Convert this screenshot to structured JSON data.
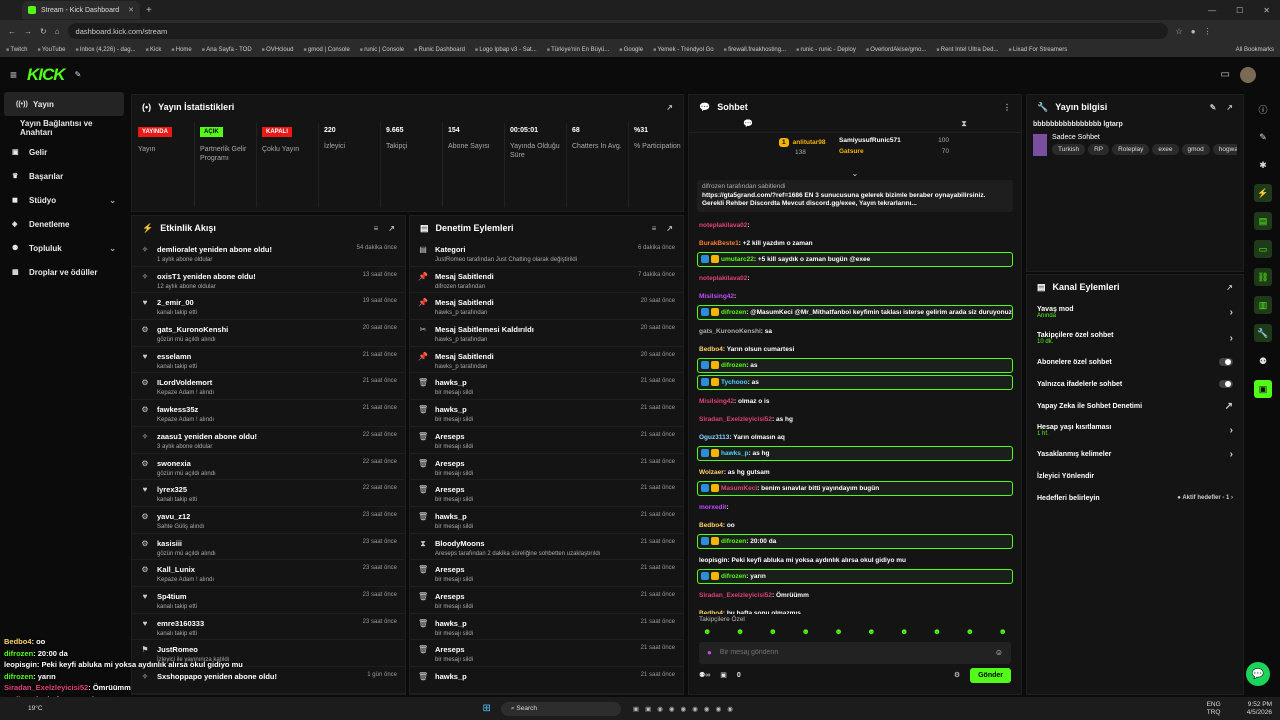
{
  "browser": {
    "tab_title": "Stream - Kick Dashboard",
    "url": "dashboard.kick.com/stream",
    "bookmarks": [
      "Twitch",
      "YouTube",
      "Inbox (4,226) - dag...",
      "Kick",
      "Home",
      "Ana Sayfa - TOD",
      "OVHcloud",
      "gmod | Console",
      "runic | Console",
      "Runic Dashboard",
      "Logo Ipbap v3 - Sat...",
      "Türkiye'nin En Büyü...",
      "Google",
      "Yemek - Trendyol Go",
      "firewall.freakhosting...",
      "runic - runic - Deploy",
      "OverlordAkise/gmo...",
      "Rent Intel Ultra Ded...",
      "Lixad For Streamers"
    ],
    "all_bookmarks": "All Bookmarks"
  },
  "header": {
    "logo": "KICK"
  },
  "sidebar": {
    "items": [
      {
        "label": "Yayın",
        "icon": "broadcast-icon"
      },
      {
        "label": "Yayın Bağlantısı ve Anahtarı",
        "icon": ""
      },
      {
        "label": "Gelir",
        "icon": "money-icon"
      },
      {
        "label": "Başarılar",
        "icon": "trophy-icon"
      },
      {
        "label": "Stüdyo",
        "icon": "studio-icon"
      },
      {
        "label": "Denetleme",
        "icon": "shield-icon"
      },
      {
        "label": "Topluluk",
        "icon": "community-icon"
      },
      {
        "label": "Droplar ve ödüller",
        "icon": "gift-icon"
      }
    ]
  },
  "stats": {
    "title": "Yayın İstatistikleri",
    "items": [
      {
        "badge": "YAYINDA",
        "label": "Yayın",
        "color": "#e91916"
      },
      {
        "badge": "AÇIK",
        "label": "Partnerlik Gelir Programı",
        "color": "#53fc18"
      },
      {
        "badge": "KAPALI",
        "label": "Çoklu Yayın",
        "color": "#e91916"
      },
      {
        "value": "220",
        "label": "İzleyici"
      },
      {
        "value": "9.665",
        "label": "Takipçi"
      },
      {
        "value": "154",
        "label": "Abone Sayısı"
      },
      {
        "value": "00:05:01",
        "label": "Yayında Olduğu Süre"
      },
      {
        "value": "68",
        "label": "Chatters In Avg."
      },
      {
        "value": "%31",
        "label": "% Participation"
      }
    ]
  },
  "activity": {
    "title": "Etkinlik Akışı",
    "rows": [
      {
        "t": "demlioralet yeniden abone oldu!",
        "s": "1 aylık abone oldular",
        "hl": "1",
        "time": "54 dakika önce",
        "icon": "star-icon"
      },
      {
        "t": "oxisT1 yeniden abone oldu!",
        "s": "12 aylık abone oldular",
        "hl": "12",
        "time": "13 saat önce",
        "icon": "star-icon"
      },
      {
        "t": "2_emir_00",
        "s": "kanalı takip etti",
        "hl": "",
        "time": "19 saat önce",
        "icon": "heart-icon"
      },
      {
        "t": "gats_KuronoKenshi",
        "s": "gözün mü açıldı alındı",
        "hl": "gözün mü açıldı",
        "time": "20 saat önce",
        "icon": "reward-icon"
      },
      {
        "t": "esselamn",
        "s": "kanalı takip etti",
        "hl": "",
        "time": "21 saat önce",
        "icon": "heart-icon"
      },
      {
        "t": "ILordVoldemort",
        "s": "Kepaze Adam ! alındı",
        "hl": "Kepaze Adam !",
        "time": "21 saat önce",
        "icon": "reward-icon"
      },
      {
        "t": "fawkess35z",
        "s": "Kepaze Adam ! alındı",
        "hl": "Kepaze Adam !",
        "time": "21 saat önce",
        "icon": "reward-icon"
      },
      {
        "t": "zaasu1 yeniden abone oldu!",
        "s": "3 aylık abone oldular",
        "hl": "3",
        "time": "22 saat önce",
        "icon": "star-icon"
      },
      {
        "t": "swonexia",
        "s": "gözün mü açıldı alındı",
        "hl": "gözün mü açıldı",
        "time": "22 saat önce",
        "icon": "reward-icon"
      },
      {
        "t": "lyrex325",
        "s": "kanalı takip etti",
        "hl": "",
        "time": "22 saat önce",
        "icon": "heart-icon"
      },
      {
        "t": "yavu_z12",
        "s": "Sahte Güliş alındı",
        "hl": "Sahte Güliş",
        "time": "23 saat önce",
        "icon": "reward-icon"
      },
      {
        "t": "kasisiii",
        "s": "gözün mü açıldı alındı",
        "hl": "gözün mü açıldı",
        "time": "23 saat önce",
        "icon": "reward-icon"
      },
      {
        "t": "Kall_Lunix",
        "s": "Kepaze Adam ! alındı",
        "hl": "Kepaze Adam !",
        "time": "23 saat önce",
        "icon": "reward-icon"
      },
      {
        "t": "Sp4tium",
        "s": "kanalı takip etti",
        "hl": "",
        "time": "23 saat önce",
        "icon": "heart-icon"
      },
      {
        "t": "emre3160333",
        "s": "kanalı takip etti",
        "hl": "",
        "time": "23 saat önce",
        "icon": "heart-icon"
      },
      {
        "t": "JustRomeo",
        "s": "İzleyici ile yayınınıza katıldı",
        "hl": "",
        "time": "",
        "icon": "raid-icon"
      },
      {
        "t": "Sxshoppapo yeniden abone oldu!",
        "s": "",
        "hl": "",
        "time": "1 gün önce",
        "icon": "star-icon"
      }
    ]
  },
  "moderation": {
    "title": "Denetim Eylemleri",
    "rows": [
      {
        "t": "Kategori",
        "s": "JustRomeo tarafından Just Chatting olarak değiştirildi",
        "time": "6 dakika önce",
        "icon": "category-icon"
      },
      {
        "t": "Mesaj Sabitlendi",
        "s": "difrozen tarafından",
        "time": "7 dakika önce",
        "icon": "pin-icon"
      },
      {
        "t": "Mesaj Sabitlendi",
        "s": "hawks_p tarafından",
        "time": "20 saat önce",
        "icon": "pin-icon"
      },
      {
        "t": "Mesaj Sabitlemesi Kaldırıldı",
        "s": "hawks_p tarafından",
        "time": "20 saat önce",
        "icon": "unpin-icon"
      },
      {
        "t": "Mesaj Sabitlendi",
        "s": "hawks_p tarafından",
        "time": "20 saat önce",
        "icon": "pin-icon"
      },
      {
        "t": "hawks_p",
        "s": "bir mesajı sildi",
        "time": "21 saat önce",
        "icon": "trash-icon"
      },
      {
        "t": "hawks_p",
        "s": "bir mesajı sildi",
        "time": "21 saat önce",
        "icon": "trash-icon"
      },
      {
        "t": "Areseps",
        "s": "bir mesajı sildi",
        "time": "21 saat önce",
        "icon": "trash-icon"
      },
      {
        "t": "Areseps",
        "s": "bir mesajı sildi",
        "time": "21 saat önce",
        "icon": "trash-icon"
      },
      {
        "t": "Areseps",
        "s": "bir mesajı sildi",
        "time": "21 saat önce",
        "icon": "trash-icon"
      },
      {
        "t": "hawks_p",
        "s": "bir mesajı sildi",
        "time": "21 saat önce",
        "icon": "trash-icon"
      },
      {
        "t": "BloodyMoons",
        "s": "Areseps tarafından 2 dakika süreliğine sohbetten uzaklaştırıldı",
        "time": "21 saat önce",
        "icon": "timeout-icon"
      },
      {
        "t": "Areseps",
        "s": "bir mesajı sildi",
        "time": "21 saat önce",
        "icon": "trash-icon"
      },
      {
        "t": "Areseps",
        "s": "bir mesajı sildi",
        "time": "21 saat önce",
        "icon": "trash-icon"
      },
      {
        "t": "hawks_p",
        "s": "bir mesajı sildi",
        "time": "21 saat önce",
        "icon": "trash-icon"
      },
      {
        "t": "Areseps",
        "s": "bir mesajı sildi",
        "time": "21 saat önce",
        "icon": "trash-icon"
      },
      {
        "t": "hawks_p",
        "s": "",
        "time": "21 saat önce",
        "icon": "trash-icon"
      }
    ]
  },
  "chat": {
    "title": "Sohbet",
    "leaders": [
      {
        "rank": "1",
        "name": "anlitutar98",
        "val": "138"
      },
      {
        "name": "SamiyusufRunic571",
        "val": "100"
      },
      {
        "name": "Gatsure",
        "val": "70"
      }
    ],
    "pinned": {
      "by": "difrozen tarafından sabitlendi",
      "text": "https://gta5grand.com/?ref=1686 EN 3 sunucusuna gelerek bizimle beraber oynayabilirsiniz. Gerekli Rehber Discordta Mevcut discord.gg/exee, Yayın tekrarlarını..."
    },
    "messages": [
      {
        "u": "noteplakilava02",
        "c": "#e0417b",
        "m": "",
        "hl": false
      },
      {
        "u": "BurakBeste1",
        "c": "#ff7a2e",
        "m": "+2 kill yazdım o zaman",
        "hl": false
      },
      {
        "u": "umutarc22",
        "c": "#53fc18",
        "m": "+5 kill saydık o zaman bugün @exee",
        "hl": true
      },
      {
        "u": "noteplakilava02",
        "c": "#e0417b",
        "m": "",
        "hl": false
      },
      {
        "u": "Misilsing42",
        "c": "#c04bff",
        "m": "",
        "hl": false
      },
      {
        "u": "difrozen",
        "c": "#53fc18",
        "m": "@MasumKeci @Mr_Mithatfanboi keyfimin taklası isterse gelirim arada siz duruyonuz mu sınava mı çalışçaksınız",
        "hl": true
      },
      {
        "u": "gats_KuronoKenshi",
        "c": "#aaa",
        "m": "sa",
        "hl": false
      },
      {
        "u": "Bedbo4",
        "c": "#ffd36b",
        "m": "Yarın olsun cumartesi",
        "hl": false
      },
      {
        "u": "difrozen",
        "c": "#53fc18",
        "m": "as",
        "hl": true
      },
      {
        "u": "Tychooo",
        "c": "#4fd2ff",
        "m": "as",
        "hl": true
      },
      {
        "u": "Misilsing42",
        "c": "#e0417b",
        "m": "olmaz o is",
        "hl": false
      },
      {
        "u": "Siradan_Exelzleyicisi52",
        "c": "#e0417b",
        "m": "as hg",
        "hl": false
      },
      {
        "u": "Oguz3113",
        "c": "#8ad7ff",
        "m": "Yarın olmasın aq",
        "hl": false
      },
      {
        "u": "hawks_p",
        "c": "#4fd2ff",
        "m": "as hg",
        "hl": true
      },
      {
        "u": "Wolzaer",
        "c": "#ffd36b",
        "m": "as hg gutsam",
        "hl": false
      },
      {
        "u": "MasumKeci",
        "c": "#e0417b",
        "m": "benim sınavlar bitti yayındayım bugün",
        "hl": true
      },
      {
        "u": "morxedit",
        "c": "#c04bff",
        "m": "",
        "hl": false
      },
      {
        "u": "Bedbo4",
        "c": "#ffd36b",
        "m": "oo",
        "hl": false
      },
      {
        "u": "difrozen",
        "c": "#53fc18",
        "m": "20:00 da",
        "hl": true
      },
      {
        "u": "leopisgin",
        "c": "#fff",
        "m": "Peki keyfi abluka mi yoksa aydınlık alırsa okul gidiyo mu",
        "hl": false
      },
      {
        "u": "difrozen",
        "c": "#53fc18",
        "m": "yarın",
        "hl": true
      },
      {
        "u": "Siradan_Exelzleyicisi52",
        "c": "#e0417b",
        "m": "Ömrüümm",
        "hl": false
      },
      {
        "u": "Bedbo4",
        "c": "#ffd36b",
        "m": "bu hafta sonu olmazmış",
        "hl": false
      }
    ],
    "followers_only": "Takipçilere Özel",
    "placeholder": "Bir mesaj gönderin",
    "send": "Gönder",
    "count": "0"
  },
  "info": {
    "title": "Yayın bilgisi",
    "stream_title": "bbbbbbbbbbbbbbbb lgtarp",
    "category": "Sadece Sohbet",
    "tags": [
      "Turkish",
      "RP",
      "Roleplay",
      "exee",
      "gmod",
      "hogwar"
    ]
  },
  "channel": {
    "title": "Kanal Eylemleri",
    "items": [
      {
        "l": "Yavaş mod",
        "s": "Anında",
        "ctl": "›"
      },
      {
        "l": "Takipçilere özel sohbet",
        "s": "10 dk.",
        "ctl": "›"
      },
      {
        "l": "Abonelere özel sohbet",
        "s": "",
        "ctl": "toggle"
      },
      {
        "l": "Yalnızca ifadelerle sohbet",
        "s": "",
        "ctl": "toggle"
      },
      {
        "l": "Yapay Zeka ile Sohbet Denetimi",
        "s": "",
        "ctl": "↗"
      },
      {
        "l": "Hesap yaşı kısıtlaması",
        "s": "1 hf.",
        "ctl": "›"
      },
      {
        "l": "Yasaklanmış kelimeler",
        "s": "",
        "ctl": "›"
      },
      {
        "l": "İzleyici Yönlendir",
        "s": "",
        "ctl": ""
      },
      {
        "l": "Hedefleri belirleyin",
        "s": "",
        "ctl": "● Aktif hedefler - 1 ›"
      }
    ]
  },
  "overlay": [
    {
      "u": "Bedbo4",
      "m": ": oo",
      "c": "#ffd36b"
    },
    {
      "u": "difrozen",
      "m": ": 20:00 da",
      "c": "#53fc18"
    },
    {
      "u": "leopisgin",
      "m": ": Peki keyfi abluka mi yoksa aydınlık alırsa okul gidiyo mu",
      "c": "#fff"
    },
    {
      "u": "difrozen",
      "m": ": yarın",
      "c": "#53fc18"
    },
    {
      "u": "Siradan_Exelzleyicisi52",
      "m": ": Ömrüümm",
      "c": "#e0417b"
    },
    {
      "u": "Bedbo4",
      "m": ": bu hafta sonu olmazmış",
      "c": "#ffd36b"
    }
  ],
  "taskbar": {
    "weather": "19°C",
    "search": "Search",
    "lang": "ENG",
    "region": "TRQ",
    "time": "9:52 PM",
    "date": "4/5/2026"
  }
}
